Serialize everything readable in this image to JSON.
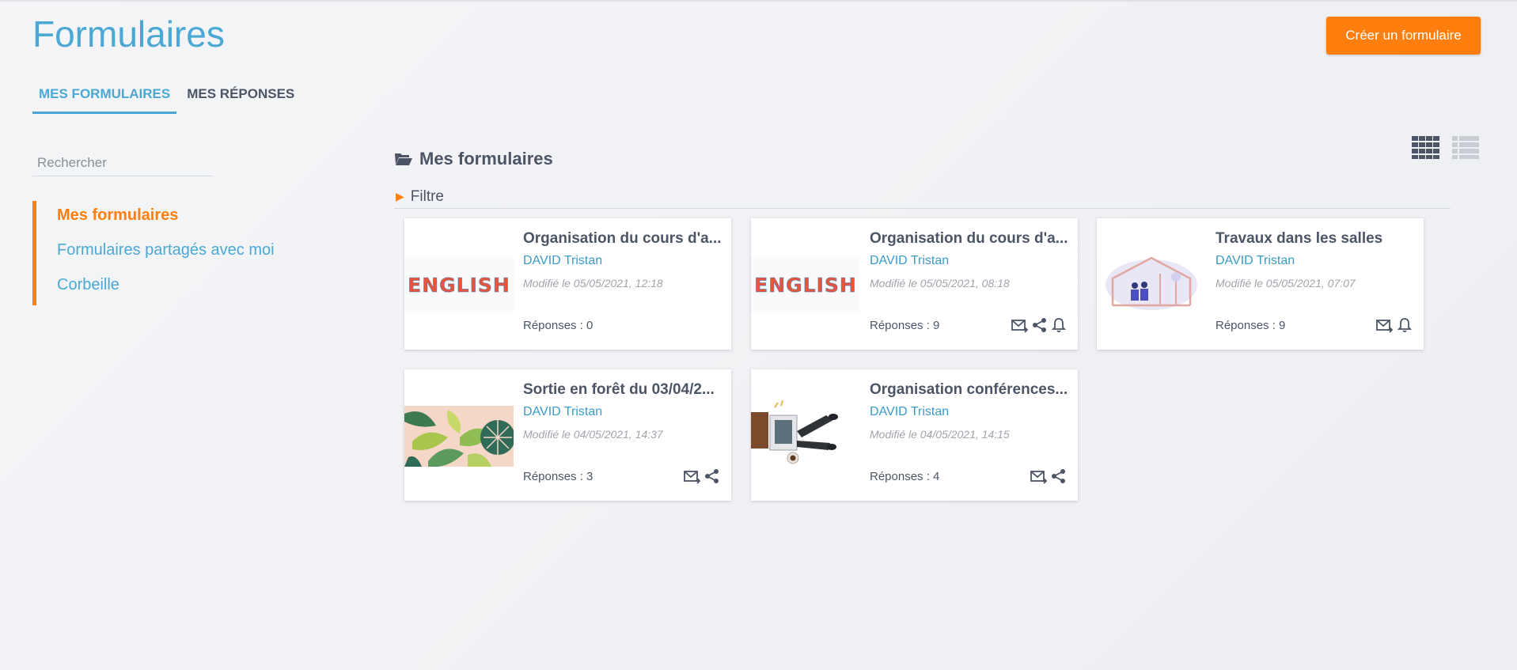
{
  "header": {
    "title": "Formulaires",
    "create_button": "Créer un formulaire"
  },
  "tabs": [
    {
      "label": "MES FORMULAIRES",
      "active": true
    },
    {
      "label": "MES RÉPONSES",
      "active": false
    }
  ],
  "sidebar": {
    "search_placeholder": "Rechercher",
    "items": [
      {
        "label": "Mes formulaires",
        "active": true
      },
      {
        "label": "Formulaires partagés avec moi"
      },
      {
        "label": "Corbeille"
      }
    ]
  },
  "main": {
    "section_title": "Mes formulaires",
    "filter_label": "Filtre",
    "view_modes": [
      "grid-view-icon",
      "list-view-icon"
    ],
    "cards": [
      {
        "title": "Organisation du cours d'a...",
        "author": "DAVID Tristan",
        "modified": "Modifié le 05/05/2021, 12:18",
        "responses": "Réponses : 0",
        "image": "english-image",
        "actions": []
      },
      {
        "title": "Organisation du cours d'a...",
        "author": "DAVID Tristan",
        "modified": "Modifié le 05/05/2021, 08:18",
        "responses": "Réponses : 9",
        "image": "english-image",
        "actions": [
          "send-mail-icon",
          "share-icon",
          "bell-icon"
        ]
      },
      {
        "title": "Travaux dans les salles",
        "author": "DAVID Tristan",
        "modified": "Modifié le 05/05/2021, 07:07",
        "responses": "Réponses : 9",
        "image": "house-construction-image",
        "actions": [
          "send-mail-icon",
          "bell-icon"
        ]
      },
      {
        "title": "Sortie en forêt du 03/04/2...",
        "author": "DAVID Tristan",
        "modified": "Modifié le 04/05/2021, 14:37",
        "responses": "Réponses : 3",
        "image": "leaves-image",
        "actions": [
          "send-mail-icon",
          "share-icon"
        ]
      },
      {
        "title": "Organisation conférences...",
        "author": "DAVID Tristan",
        "modified": "Modifié le 04/05/2021, 14:15",
        "responses": "Réponses : 4",
        "image": "desk-image",
        "actions": [
          "send-mail-icon",
          "share-icon"
        ]
      }
    ]
  },
  "colors": {
    "accent_blue": "#4ba8d4",
    "accent_orange": "#ff7e0d",
    "text_dark": "#4c5566"
  }
}
